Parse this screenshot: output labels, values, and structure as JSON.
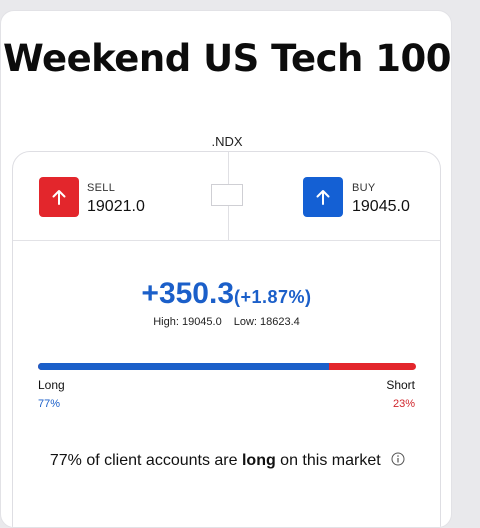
{
  "market": {
    "title": "Weekend US Tech 100",
    "ticker": ".NDX"
  },
  "sell": {
    "label": "SELL",
    "price": "19021.0",
    "color": "#e3262c",
    "icon": "arrow-up-icon"
  },
  "buy": {
    "label": "BUY",
    "price": "19045.0",
    "color": "#1460d4",
    "icon": "arrow-up-icon"
  },
  "change": {
    "value": "+350.3",
    "percent": "(+1.87%)",
    "high": "High: 19045.0",
    "low": "Low: 18623.4",
    "color": "#1b5fc9"
  },
  "sentiment": {
    "long_label": "Long",
    "short_label": "Short",
    "long_pct_text": "77%",
    "short_pct_text": "23%",
    "long_fraction": 0.77,
    "text_prefix": "77% of client accounts are ",
    "text_bold": "long",
    "text_suffix": " on this market",
    "info_icon": "info-icon"
  }
}
